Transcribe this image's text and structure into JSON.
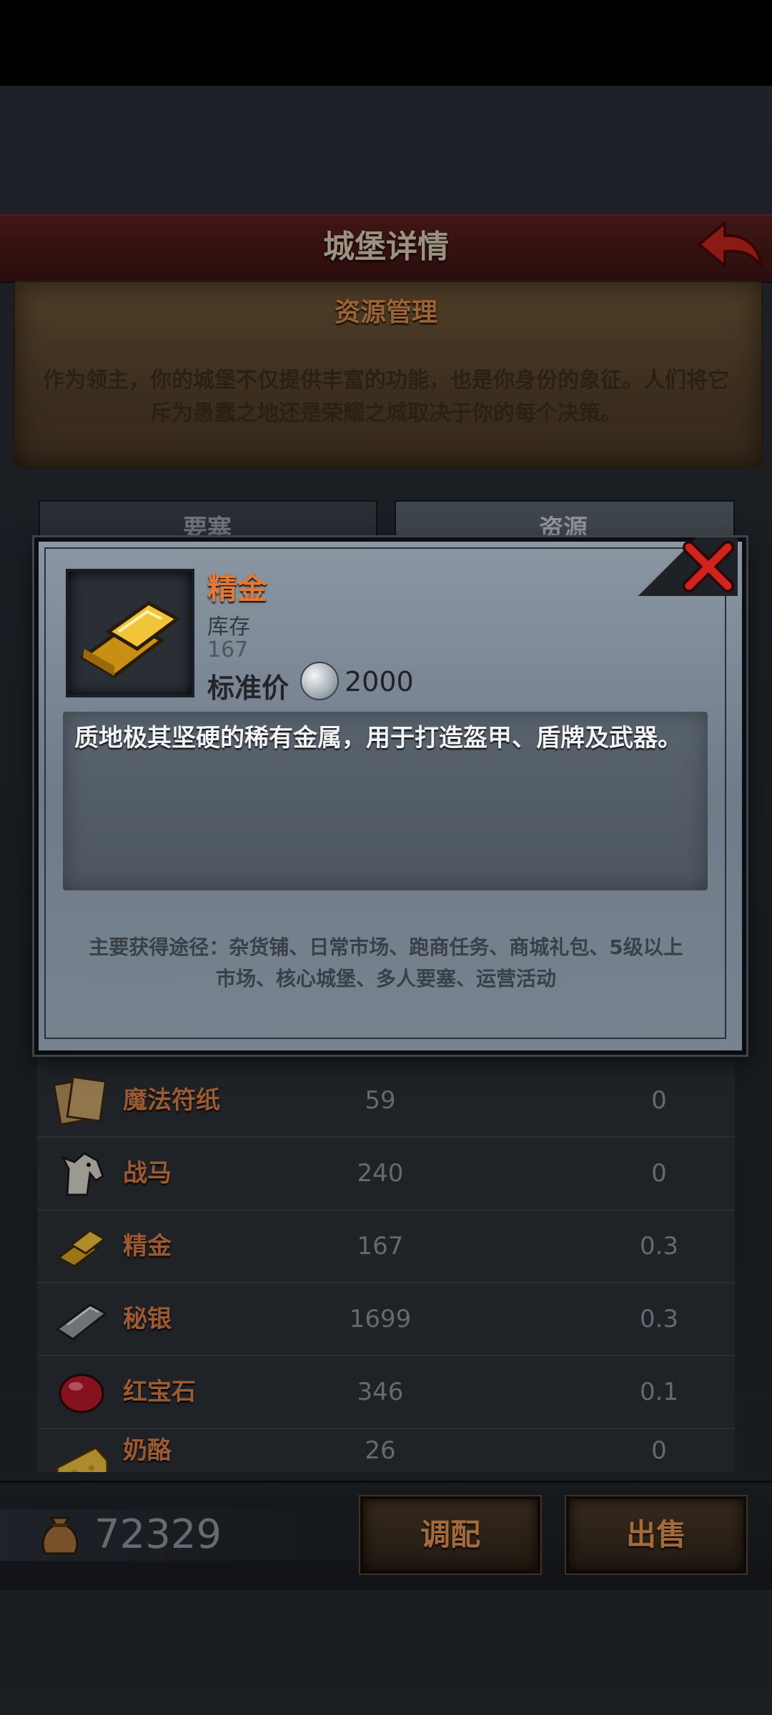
{
  "header": {
    "title": "城堡详情"
  },
  "panel": {
    "title": "资源管理",
    "description": "作为领主，你的城堡不仅提供丰富的功能，也是你身份的象征。人们将它斥为愚蠢之地还是荣耀之城取决于你的每个决策。"
  },
  "tabs": [
    {
      "label": "要塞"
    },
    {
      "label": "资源"
    }
  ],
  "modal": {
    "item_name": "精金",
    "stock_label": "库存",
    "stock_value": "167",
    "price_label": "标准价",
    "price_value": "2000",
    "description": "质地极其坚硬的稀有金属，用于打造盔甲、盾牌及武器。",
    "sources": "主要获得途径：杂货铺、日常市场、跑商任务、商城礼包、5级以上市场、核心城堡、多人要塞、运营活动"
  },
  "resources": [
    {
      "name": "魔法符纸",
      "quantity": "59",
      "value": "0",
      "icon": "magic-paper-icon"
    },
    {
      "name": "战马",
      "quantity": "240",
      "value": "0",
      "icon": "warhorse-icon"
    },
    {
      "name": "精金",
      "quantity": "167",
      "value": "0.3",
      "icon": "gold-bar-icon"
    },
    {
      "name": "秘银",
      "quantity": "1699",
      "value": "0.3",
      "icon": "mithril-bar-icon"
    },
    {
      "name": "红宝石",
      "quantity": "346",
      "value": "0.1",
      "icon": "ruby-icon"
    },
    {
      "name": "奶酪",
      "quantity": "26",
      "value": "0",
      "icon": "cheese-icon"
    }
  ],
  "footer": {
    "coins": "72329",
    "adjust_label": "调配",
    "sell_label": "出售"
  },
  "colors": {
    "accent_orange": "#e07a35",
    "header_red": "#5a1f1f",
    "parchment": "#6e5638",
    "modal_steel": "#7b8793"
  }
}
